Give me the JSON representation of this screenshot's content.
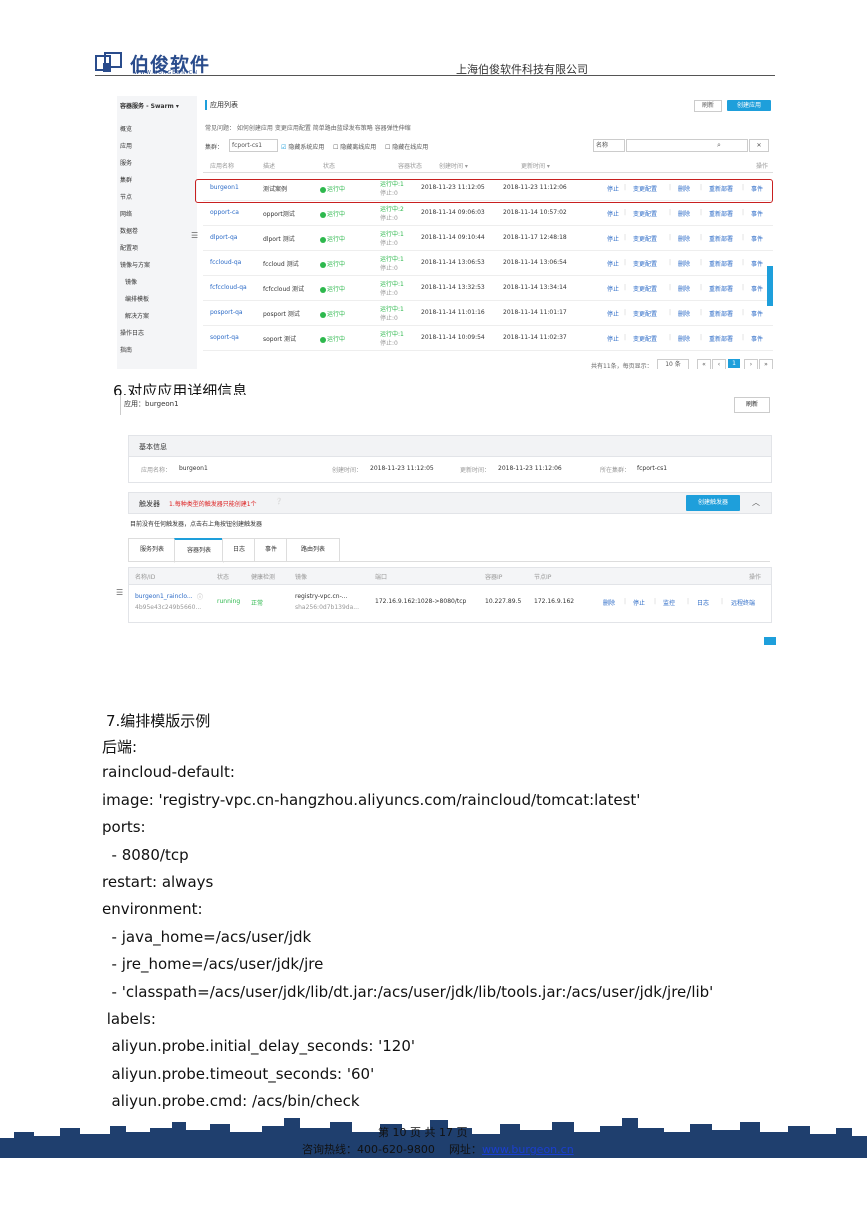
{
  "header": {
    "logo_text": "伯俊软件",
    "logo_sub": "WWW.BURGEON.CN",
    "company": "上海伯俊软件科技有限公司"
  },
  "screenshot1": {
    "sidebar": [
      "容器服务 - Swarm ▾",
      "概览",
      "应用",
      "服务",
      "集群",
      "节点",
      "网络",
      "数据卷",
      "配置项",
      "镜像与方案",
      "镜像",
      "编排模板",
      "解决方案",
      "操作日志",
      "指南"
    ],
    "title": "应用列表",
    "refresh": "刷新",
    "create": "创建应用",
    "quick_links": "常见问题： 如何创建应用   变更应用配置   简单路由蓝绿发布策略   容器弹性伸缩",
    "cluster_label": "集群：",
    "cluster_value": "fcport-cs1",
    "filter1": "隐藏系统应用",
    "filter2": "隐藏离线应用",
    "filter3": "隐藏在线应用",
    "search_select": "名称",
    "columns": [
      "应用名称",
      "描述",
      "状态",
      "容器状态",
      "创建时间 ▾",
      "更新时间 ▾",
      "操作"
    ],
    "rows": [
      {
        "name": "burgeon1",
        "desc": "测试案例",
        "status": "运行中",
        "cstate1": "运行中:1",
        "cstate2": "停止:0",
        "created": "2018-11-23 11:12:05",
        "updated": "2018-11-23 11:12:06"
      },
      {
        "name": "opport-ca",
        "desc": "opport测试",
        "status": "运行中",
        "cstate1": "运行中:2",
        "cstate2": "停止:0",
        "created": "2018-11-14 09:06:03",
        "updated": "2018-11-14 10:57:02"
      },
      {
        "name": "dlport-qa",
        "desc": "dlport 测试",
        "status": "运行中",
        "cstate1": "运行中:1",
        "cstate2": "停止:0",
        "created": "2018-11-14 09:10:44",
        "updated": "2018-11-17 12:48:18"
      },
      {
        "name": "fccloud-qa",
        "desc": "fccloud 测试",
        "status": "运行中",
        "cstate1": "运行中:1",
        "cstate2": "停止:0",
        "created": "2018-11-14 13:06:53",
        "updated": "2018-11-14 13:06:54"
      },
      {
        "name": "fcfccloud-qa",
        "desc": "fcfccloud 测试",
        "status": "运行中",
        "cstate1": "运行中:1",
        "cstate2": "停止:0",
        "created": "2018-11-14 13:32:53",
        "updated": "2018-11-14 13:34:14"
      },
      {
        "name": "posport-qa",
        "desc": "posport 测试",
        "status": "运行中",
        "cstate1": "运行中:1",
        "cstate2": "停止:0",
        "created": "2018-11-14 11:01:16",
        "updated": "2018-11-14 11:01:17"
      },
      {
        "name": "soport-qa",
        "desc": "soport 测试",
        "status": "运行中",
        "cstate1": "运行中:1",
        "cstate2": "停止:0",
        "created": "2018-11-14 10:09:54",
        "updated": "2018-11-14 11:02:37"
      }
    ],
    "ops": [
      "停止",
      "变更配置",
      "删除",
      "重新部署",
      "事件"
    ],
    "pager": "共有11条，每页显示：",
    "pager_size": "10 条",
    "pager_current": "1"
  },
  "section6": "6.对应应用详细信息",
  "screenshot2": {
    "app_label": "应用：burgeon1",
    "refresh": "刷新",
    "basic_title": "基本信息",
    "app_name_label": "应用名称：",
    "app_name": "burgeon1",
    "created_label": "创建时间：",
    "created": "2018-11-23 11:12:05",
    "updated_label": "更新时间：",
    "updated": "2018-11-23 11:12:06",
    "cluster_label": "所在集群：",
    "cluster": "fcport-cs1",
    "trigger_title": "触发器",
    "trigger_warn": "1.每种类型的触发器只能创建1个",
    "create_trigger": "创建触发器",
    "no_trigger": "目前没有任何触发器，点击右上角按钮创建触发器",
    "tabs": [
      "服务列表",
      "容器列表",
      "日志",
      "事件",
      "路由列表"
    ],
    "columns": [
      "名称/ID",
      "状态",
      "健康检测",
      "镜像",
      "端口",
      "容器IP",
      "节点IP",
      "操作"
    ],
    "container": {
      "name": "burgeon1_rainclo...",
      "id": "4b95e43c249b5660...",
      "status": "running",
      "health": "正常",
      "image1": "registry-vpc.cn-...",
      "image2": "sha256:0d7b139da...",
      "port": "172.16.9.162:1028->8080/tcp",
      "cip": "10.227.89.5",
      "nip": "172.16.9.162",
      "ops": [
        "删除",
        "停止",
        "监控",
        "日志",
        "远程终端"
      ]
    }
  },
  "section7": "7.编排模版示例",
  "code_lines": [
    "后端:",
    "raincloud-default:",
    "image: 'registry-vpc.cn-hangzhou.aliyuncs.com/raincloud/tomcat:latest'",
    "ports:",
    "  - 8080/tcp",
    "restart: always",
    "environment:",
    "  - java_home=/acs/user/jdk",
    "  - jre_home=/acs/user/jdk/jre",
    "  - 'classpath=/acs/user/jdk/lib/dt.jar:/acs/user/jdk/lib/tools.jar:/acs/user/jdk/jre/lib'",
    " labels:",
    "  aliyun.probe.initial_delay_seconds: '120'",
    "  aliyun.probe.timeout_seconds: '60'",
    "  aliyun.probe.cmd: /acs/bin/check"
  ],
  "footer": {
    "page": "第 10 页  共 17 页",
    "hotline_label": "咨询热线：400-620-9800",
    "site_label": "网址：",
    "site": "www.burgeon.cn"
  },
  "colors": {
    "brand": "#2a4c8c",
    "link": "#2c6bc7",
    "running": "#2db84d",
    "highlight": "#c82020",
    "button": "#1e9fdb",
    "footer_band": "#1f3f6e"
  }
}
